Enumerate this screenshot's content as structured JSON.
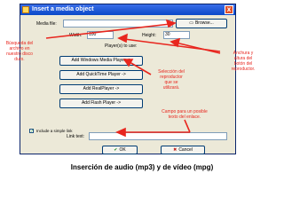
{
  "window": {
    "title": "Insert a media object",
    "close_glyph": "x"
  },
  "form": {
    "media_file_label": "Media file:",
    "media_file_value": "",
    "browse_label": "Browse...",
    "width_label": "Width:",
    "width_value": "100",
    "height_label": "Height:",
    "height_value": "30",
    "players_label": "Player(s) to use:",
    "player_buttons": [
      "Add Windows Media Player ->",
      "Add QuickTime Player ->",
      "Add RealPlayer ->",
      "Add Flash Player ->"
    ],
    "include_simple_link_label": "Include a simple link",
    "include_simple_link_checked": true,
    "link_text_label": "Link text:",
    "link_text_value": "",
    "ok_label": "OK",
    "cancel_label": "Cancel"
  },
  "annotations": {
    "search_file": [
      "Búsqueda del",
      "archivo en",
      "nuestro disco",
      "duro."
    ],
    "size": [
      "Anchura y",
      "altura del",
      "botón del",
      "reproductor."
    ],
    "player_select": [
      "Selección del",
      "reproductor",
      "que se",
      "utilizará."
    ],
    "link_text": [
      "Campo para un posible",
      "texto del enlace."
    ]
  },
  "caption": "Inserción de audio (mp3) y de vídeo (mpg)",
  "colors": {
    "annotation": "#e8261e",
    "titlebar": "#0a48c8",
    "dialog": "#ece9d8"
  },
  "icons": {
    "window": "window-app-icon",
    "ok": "check-icon",
    "cancel": "cross-icon"
  }
}
